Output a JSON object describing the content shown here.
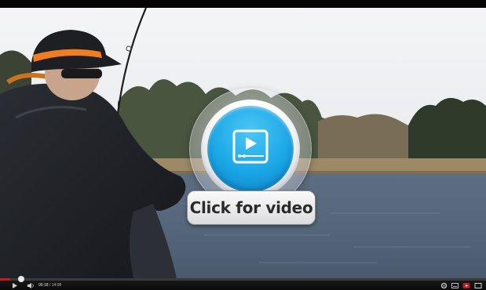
{
  "overlay": {
    "cta_label": "Click for video",
    "play_icon": "video-play-icon",
    "accent_color": "#1aa6e6"
  },
  "player": {
    "current_time": "00:18",
    "separator": " / ",
    "duration": "14:08",
    "progress": 0.021,
    "progress_color": "#cc181e",
    "icons": [
      "play-icon",
      "volume-icon",
      "settings-icon",
      "captions-icon",
      "youtube-icon",
      "fullscreen-icon"
    ]
  }
}
